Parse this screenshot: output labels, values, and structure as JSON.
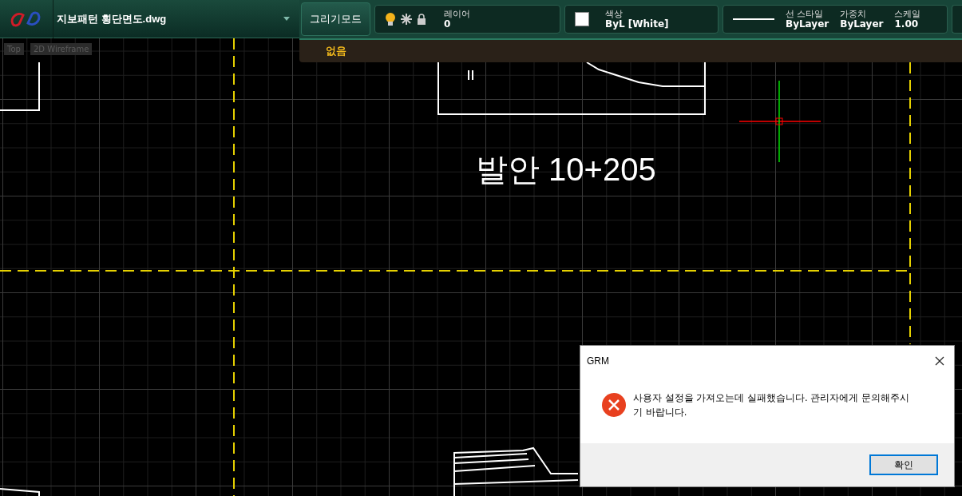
{
  "file": {
    "name": "지보패턴 횡단면도.dwg"
  },
  "toolbar": {
    "mode_button": "그리기모드",
    "layer": {
      "label": "레이어",
      "value": "0"
    },
    "color": {
      "label": "색상",
      "value": "ByL [White]"
    },
    "properties": [
      {
        "label": "선 스타일",
        "value": "ByLayer"
      },
      {
        "label": "가중치",
        "value": "ByLayer"
      },
      {
        "label": "스케일",
        "value": "1.00"
      }
    ]
  },
  "substrip": {
    "label": "없음"
  },
  "viewport": {
    "view": "Top",
    "visual_style": "2D Wireframe",
    "labels": [
      {
        "text": "발안 10+205",
        "kind": "station"
      }
    ]
  },
  "dialog": {
    "title": "GRM",
    "message": "사용자 설정을 가져오는데 실패했습니다. 관리자에게 문의해주시기 바랍니다.",
    "buttons": [
      {
        "label": "확인",
        "selected": true
      }
    ]
  }
}
